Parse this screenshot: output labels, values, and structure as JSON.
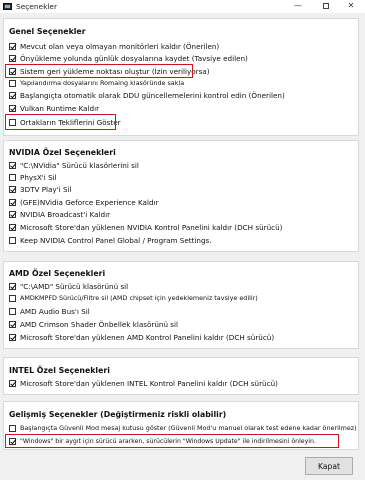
{
  "window": {
    "title": "Seçenekler",
    "min": "—",
    "close": "✕"
  },
  "sections": [
    {
      "title": "Genel Seçenekler",
      "options": [
        {
          "label": "Mevcut olan veya olmayan monitörleri kaldır (Önerilen)",
          "checked": true
        },
        {
          "label": "Önyükleme yolunda günlük dosyalarına kaydet (Tavsiye edilen)",
          "checked": true
        },
        {
          "label": "Sistem geri yükleme noktası oluştur (İzin veriliyorsa)",
          "checked": true
        },
        {
          "label": "Yapılandırma dosyalarını Romaing klasöründe sakla",
          "checked": false
        },
        {
          "label": "Başlangıçta otomatik olarak DDU güncellemelerini kontrol edin (Önerilen)",
          "checked": true
        },
        {
          "label": "Vulkan Runtime Kaldır",
          "checked": true
        },
        {
          "label": "Ortakların Tekliflerini Göster",
          "checked": false
        }
      ]
    },
    {
      "title": "NVIDIA Özel Seçenekleri",
      "options": [
        {
          "label": "\"C:\\NVidia\" Sürücü klasörlerini sil",
          "checked": true
        },
        {
          "label": "PhysX'i Sil",
          "checked": false
        },
        {
          "label": "3DTV Play'i Sil",
          "checked": true
        },
        {
          "label": "(GFE)NVidia Geforce Experience Kaldır",
          "checked": true
        },
        {
          "label": "NVIDIA Broadcast'i Kaldır",
          "checked": true
        },
        {
          "label": "Microsoft Store'dan yüklenen NVIDIA Kontrol Panelini kaldır (DCH sürücü)",
          "checked": true
        },
        {
          "label": "Keep NVIDIA Control Panel Global / Program Settings.",
          "checked": false
        }
      ]
    },
    {
      "title": "AMD Özel Seçenekleri",
      "options": [
        {
          "label": "\"C:\\AMD\" Sürücü klasörünü sil",
          "checked": true
        },
        {
          "label": "AMDKMPFD Sürücü/Filtre sil (AMD chipset için yedeklemeniz tavsiye edilir)",
          "checked": false
        },
        {
          "label": "AMD Audio Bus'ı Sil",
          "checked": false
        },
        {
          "label": "AMD Crimson Shader Önbellek klasörünü sil",
          "checked": true
        },
        {
          "label": "Microsoft Store'dan yüklenen AMD Kontrol Panelini kaldır (DCH sürücü)",
          "checked": true
        }
      ]
    },
    {
      "title": "INTEL Özel Seçenekleri",
      "options": [
        {
          "label": "Microsoft Store'dan yüklenen INTEL Kontrol Panelini kaldır (DCH sürücü)",
          "checked": true
        }
      ]
    },
    {
      "title": "Gelişmiş Seçenekler (Değiştirmeniz riskli olabilir)",
      "options": [
        {
          "label": "Başlangıçta Güvenli Mod mesaj kutusu göster (Güvenli Mod'u manuel olarak test edene kadar önerilmez)",
          "checked": false
        },
        {
          "label": "\"Windows\" bir aygıt için sürücü ararken, sürücülerin \"Windows Update\" ile indirilmesini önleyin.",
          "checked": true
        }
      ]
    }
  ],
  "close_button": "Kapat",
  "colors": {
    "highlight": "#d0141f",
    "panel": "#ffffff",
    "window": "#f0f0f0"
  }
}
